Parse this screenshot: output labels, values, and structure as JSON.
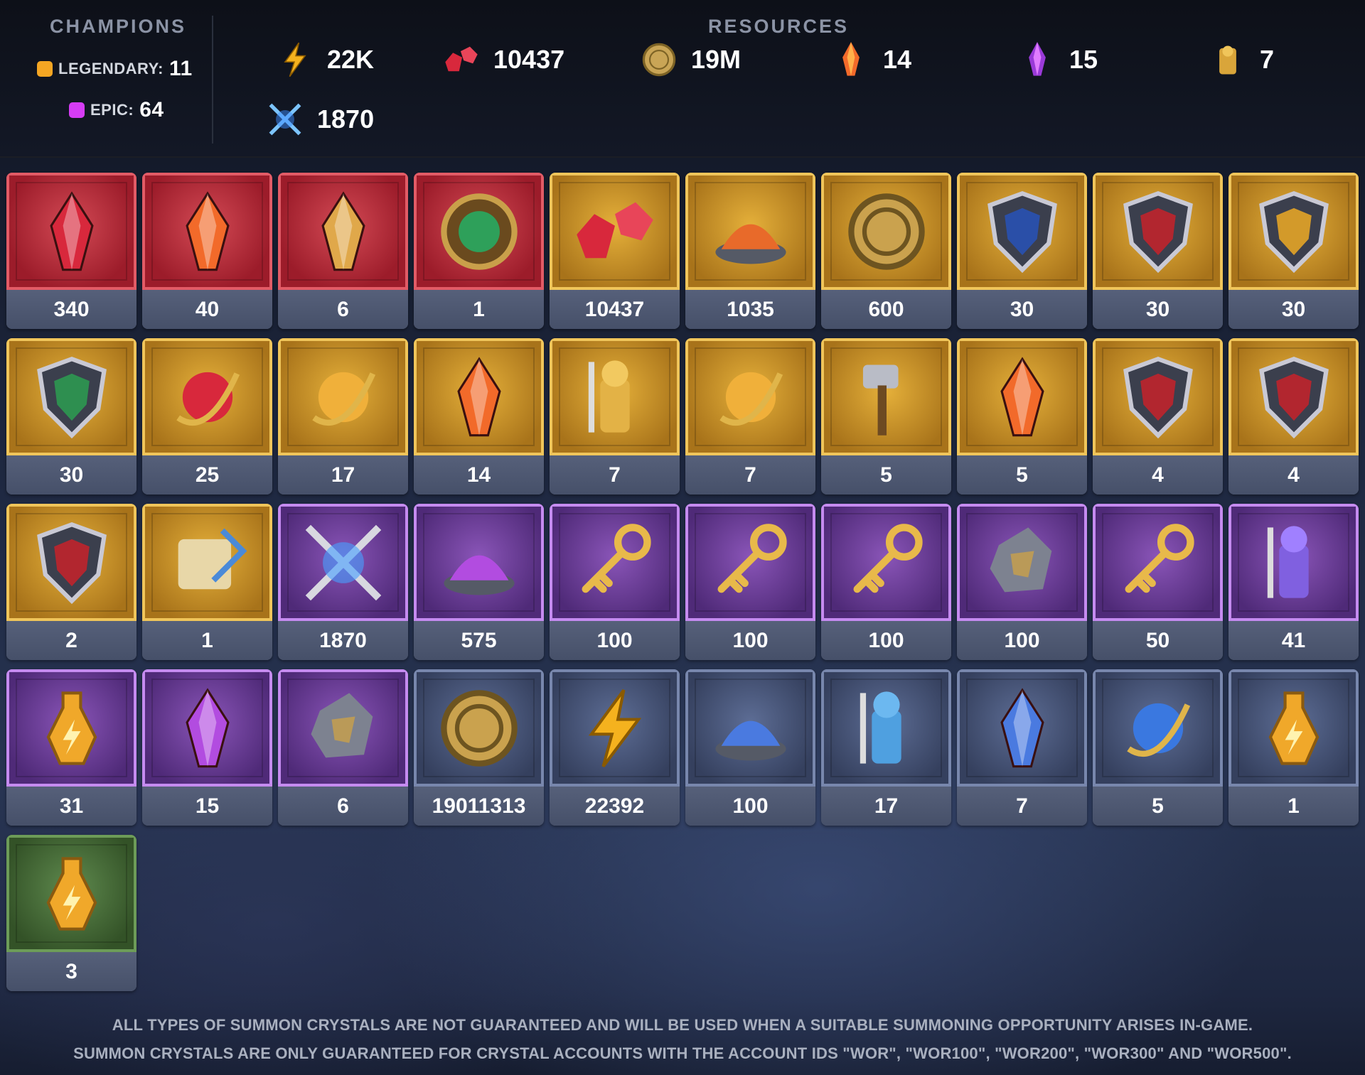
{
  "champions": {
    "title": "CHAMPIONS",
    "legendary_label": "LEGENDARY:",
    "legendary_count": "11",
    "epic_label": "EPIC:",
    "epic_count": "64",
    "legendary_color": "#f5a623",
    "epic_color": "#d63cf5"
  },
  "resources": {
    "title": "RESOURCES",
    "items": [
      {
        "icon": "energy-icon",
        "value": "22K"
      },
      {
        "icon": "ruby-gems-icon",
        "value": "10437"
      },
      {
        "icon": "silver-coin-icon",
        "value": "19M"
      },
      {
        "icon": "sacred-shard-icon",
        "value": "14"
      },
      {
        "icon": "void-shard-icon",
        "value": "15"
      },
      {
        "icon": "gold-champion-icon",
        "value": "7"
      },
      {
        "icon": "arena-token-icon",
        "value": "1870"
      }
    ]
  },
  "items": [
    {
      "icon": "ancient-shard-icon",
      "count": "340",
      "rarity": "red"
    },
    {
      "icon": "sacred-shard-bundle-icon",
      "count": "40",
      "rarity": "red"
    },
    {
      "icon": "mystery-shard-icon",
      "count": "6",
      "rarity": "red"
    },
    {
      "icon": "chameleon-token-icon",
      "count": "1",
      "rarity": "red"
    },
    {
      "icon": "gems-icon",
      "count": "10437",
      "rarity": "gold"
    },
    {
      "icon": "dust-pile-icon",
      "count": "1035",
      "rarity": "gold"
    },
    {
      "icon": "gold-medal-icon",
      "count": "600",
      "rarity": "gold"
    },
    {
      "icon": "blue-forge-shield-icon",
      "count": "30",
      "rarity": "gold"
    },
    {
      "icon": "red-forge-shield-icon",
      "count": "30",
      "rarity": "gold"
    },
    {
      "icon": "gold-forge-shield-icon",
      "count": "30",
      "rarity": "gold"
    },
    {
      "icon": "green-forge-shield-icon",
      "count": "30",
      "rarity": "gold"
    },
    {
      "icon": "red-gem-ornament-icon",
      "count": "25",
      "rarity": "gold"
    },
    {
      "icon": "gold-orb-icon",
      "count": "17",
      "rarity": "gold"
    },
    {
      "icon": "primal-shard-icon",
      "count": "14",
      "rarity": "gold"
    },
    {
      "icon": "gold-knight-icon",
      "count": "7",
      "rarity": "gold"
    },
    {
      "icon": "gold-brew-icon",
      "count": "7",
      "rarity": "gold"
    },
    {
      "icon": "hammer-icon",
      "count": "5",
      "rarity": "gold"
    },
    {
      "icon": "fire-shard-icon",
      "count": "5",
      "rarity": "gold"
    },
    {
      "icon": "strength-crest-icon",
      "count": "4",
      "rarity": "gold"
    },
    {
      "icon": "sun-crest-icon",
      "count": "4",
      "rarity": "gold"
    },
    {
      "icon": "sword-crest-icon",
      "count": "2",
      "rarity": "gold"
    },
    {
      "icon": "scroll-quill-icon",
      "count": "1",
      "rarity": "gold"
    },
    {
      "icon": "crossed-swords-icon",
      "count": "1870",
      "rarity": "purple"
    },
    {
      "icon": "purple-dust-icon",
      "count": "575",
      "rarity": "purple"
    },
    {
      "icon": "diamond-key-icon",
      "count": "100",
      "rarity": "purple"
    },
    {
      "icon": "triangle-key-icon",
      "count": "100",
      "rarity": "purple"
    },
    {
      "icon": "circle-key-icon",
      "count": "100",
      "rarity": "purple"
    },
    {
      "icon": "ore-chunk-icon",
      "count": "100",
      "rarity": "purple"
    },
    {
      "icon": "ruby-key-icon",
      "count": "50",
      "rarity": "purple"
    },
    {
      "icon": "purple-knight-icon",
      "count": "41",
      "rarity": "purple"
    },
    {
      "icon": "purple-potion-icon",
      "count": "31",
      "rarity": "purple"
    },
    {
      "icon": "void-crystal-icon",
      "count": "15",
      "rarity": "purple"
    },
    {
      "icon": "rune-stone-icon",
      "count": "6",
      "rarity": "purple"
    },
    {
      "icon": "silver-coin-icon",
      "count": "19011313",
      "rarity": "blue"
    },
    {
      "icon": "energy-bolt-icon",
      "count": "22392",
      "rarity": "blue"
    },
    {
      "icon": "blue-dust-icon",
      "count": "100",
      "rarity": "blue"
    },
    {
      "icon": "blue-knight-icon",
      "count": "17",
      "rarity": "blue"
    },
    {
      "icon": "blue-crystal-icon",
      "count": "7",
      "rarity": "blue"
    },
    {
      "icon": "blue-gem-ornament-icon",
      "count": "5",
      "rarity": "blue"
    },
    {
      "icon": "round-potion-icon",
      "count": "1",
      "rarity": "blue"
    },
    {
      "icon": "small-potion-icon",
      "count": "3",
      "rarity": "green"
    }
  ],
  "disclaimer": {
    "line1": "ALL TYPES OF SUMMON CRYSTALS ARE NOT GUARANTEED AND WILL BE USED WHEN A SUITABLE SUMMONING OPPORTUNITY ARISES IN-GAME.",
    "line2": "SUMMON CRYSTALS ARE ONLY GUARANTEED FOR CRYSTAL ACCOUNTS WITH THE ACCOUNT IDS \"WOR\", \"WOR100\", \"WOR200\", \"WOR300\" AND \"WOR500\"."
  }
}
